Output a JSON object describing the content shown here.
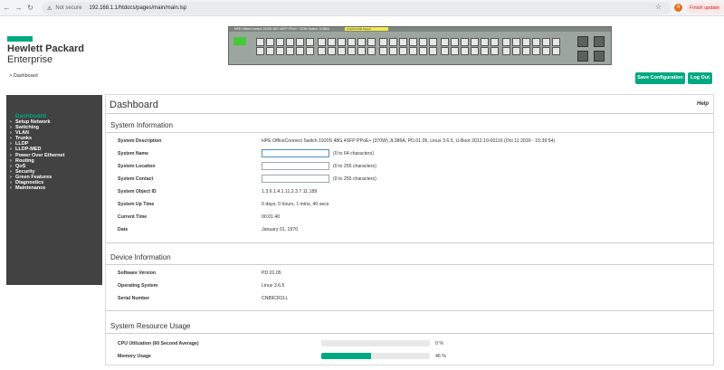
{
  "browser": {
    "security": "Not secure",
    "url": "192.168.1.1/htdocs/pages/main/main.lsp",
    "profile_initial": "A",
    "finish_update": "Finish update"
  },
  "brand": {
    "line1": "Hewlett Packard",
    "line2": "Enterprise"
  },
  "breadcrumb": "> Dashboard",
  "switch_image": {
    "model": "HPE OfficeConnect 1920S 48G 4SFP PPoE+ 370W Switch JL386A",
    "tag": "Link/Act PoE Speed",
    "accent": "#f5e94a"
  },
  "toolbar": {
    "save": "Save Configuration",
    "logout": "Log Out"
  },
  "sidebar": {
    "active": "Dashboard",
    "items": [
      "Setup Network",
      "Switching",
      "VLAN",
      "Trunks",
      "LLDP",
      "LLDP-MED",
      "Power Over Ethernet",
      "Routing",
      "QoS",
      "Security",
      "Green Features",
      "Diagnostics",
      "Maintenance"
    ]
  },
  "main": {
    "title": "Dashboard",
    "help": "Help",
    "system": {
      "heading": "System Information",
      "description_label": "System Description",
      "description_value": "HPE OfficeConnect Switch 1920S 48G 4SFP PPoE+ (370W) JL386A, PD.01.05, Linux 3.6.5, U-Boot 2012.10-00116 (Oct 11 2016 - 15:39:54)",
      "name_label": "System Name",
      "name_value": "",
      "name_hint": "(0 to 64 characters)",
      "location_label": "System Location",
      "location_value": "",
      "location_hint": "(0 to 255 characters)",
      "contact_label": "System Contact",
      "contact_value": "",
      "contact_hint": "(0 to 255 characters)",
      "oid_label": "System Object ID",
      "oid_value": "1.3.6.1.4.1.11.2.3.7.11.189",
      "uptime_label": "System Up Time",
      "uptime_value": "0 days, 0 hours, 1 mins, 40 secs",
      "time_label": "Current Time",
      "time_value": "00:01:40",
      "date_label": "Date",
      "date_value": "January 01, 1970"
    },
    "device": {
      "heading": "Device Information",
      "sw_label": "Software Version",
      "sw_value": "PD.01.05",
      "os_label": "Operating System",
      "os_value": "Linux 3.6.5",
      "serial_label": "Serial Number",
      "serial_value": "CN89CR2LL"
    },
    "resources": {
      "heading": "System Resource Usage",
      "cpu_label": "CPU Utilization (60 Second Average)",
      "cpu_percent": 0,
      "cpu_text": "0 %",
      "mem_label": "Memory Usage",
      "mem_percent": 46,
      "mem_text": "46 %"
    }
  },
  "colors": {
    "accent": "#01a982",
    "sidebar_bg": "#424242"
  }
}
